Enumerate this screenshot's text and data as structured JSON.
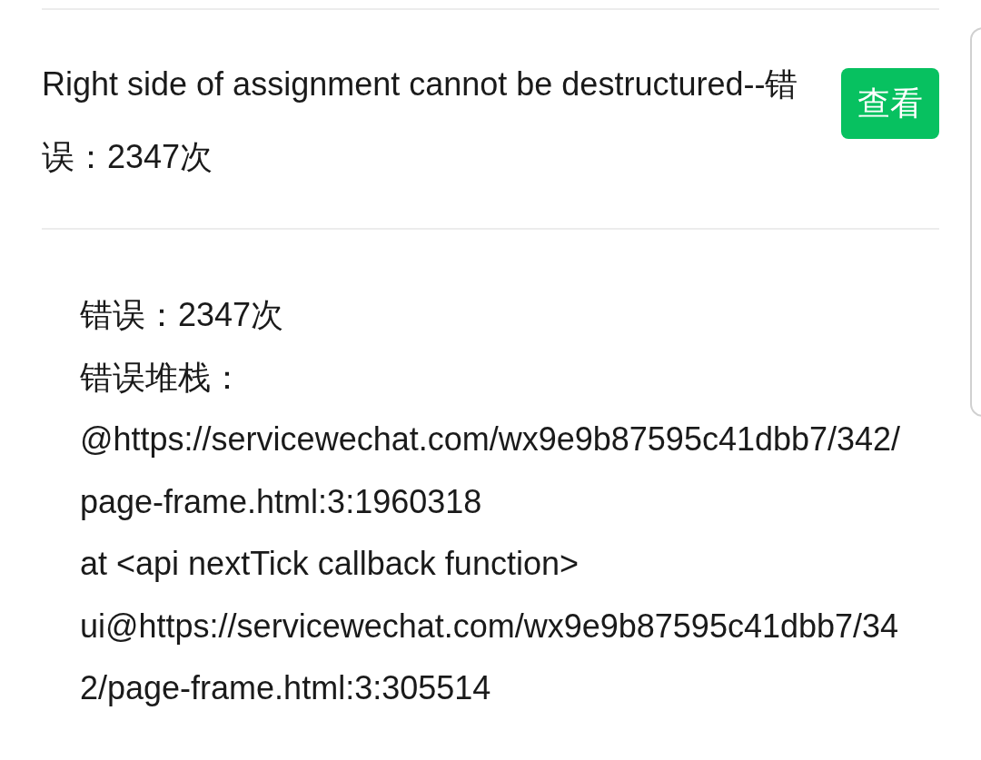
{
  "error_item": {
    "title": "Right side of assignment cannot be destructured--错误：2347次",
    "button": "查看"
  },
  "detail": {
    "lines": [
      "错误：2347次",
      "错误堆栈：",
      "@https://servicewechat.com/wx9e9b87595c41dbb7/342/page-frame.html:3:1960318",
      "at <api nextTick callback function>",
      "ui@https://servicewechat.com/wx9e9b87595c41dbb7/342/page-frame.html:3:305514"
    ]
  }
}
